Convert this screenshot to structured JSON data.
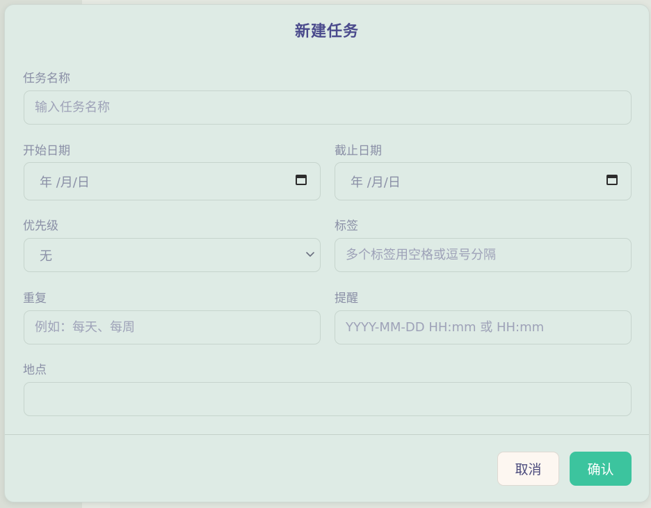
{
  "dialog": {
    "title": "新建任务"
  },
  "fields": {
    "name": {
      "label": "任务名称",
      "placeholder": "输入任务名称"
    },
    "start_date": {
      "label": "开始日期",
      "value": "年 /月/日"
    },
    "due_date": {
      "label": "截止日期",
      "value": "年 /月/日"
    },
    "priority": {
      "label": "优先级",
      "selected": "无"
    },
    "tags": {
      "label": "标签",
      "placeholder": "多个标签用空格或逗号分隔"
    },
    "repeat": {
      "label": "重复",
      "placeholder": "例如：每天、每周"
    },
    "reminder": {
      "label": "提醒",
      "placeholder": "YYYY-MM-DD HH:mm 或 HH:mm"
    },
    "location": {
      "label": "地点",
      "placeholder": ""
    }
  },
  "footer": {
    "cancel_label": "取消",
    "confirm_label": "确认"
  },
  "colors": {
    "accent": "#3cc49e",
    "title": "#4a4a8c",
    "panel": "#deebe5"
  },
  "icons": {
    "date": "calendar-icon",
    "select": "chevron-down-icon"
  }
}
